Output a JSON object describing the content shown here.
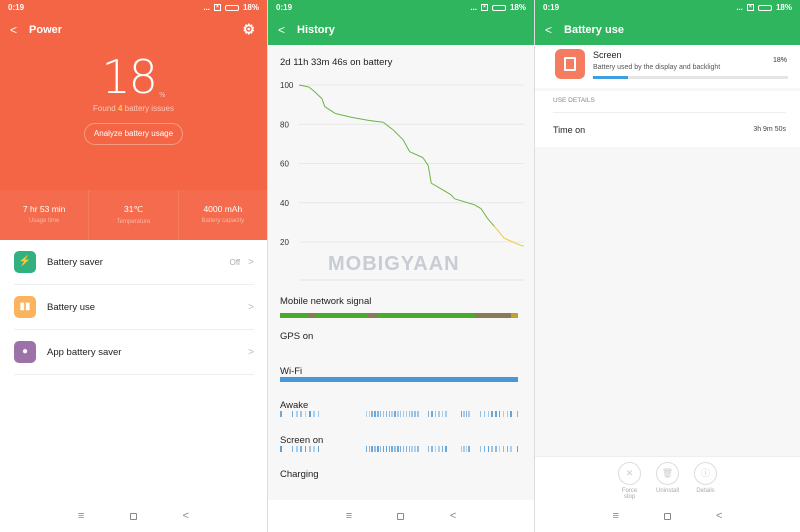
{
  "status": {
    "time": "0:19",
    "battery": "18%",
    "dots": "..."
  },
  "power": {
    "title": "Power",
    "percent": "18",
    "percent_unit": "%",
    "found_pre": "Found ",
    "issues": "4",
    "found_post": " battery issues",
    "analyze": "Analyze battery usage",
    "stats": [
      {
        "value": "7 hr 53 min",
        "label": "Usage time"
      },
      {
        "value": "31℃",
        "label": "Temperature"
      },
      {
        "value": "4000 mAh",
        "label": "Battery capacity"
      }
    ],
    "menu": [
      {
        "label": "Battery saver",
        "value": "Off",
        "icon": "battery-bolt-icon",
        "color": "#33b07f"
      },
      {
        "label": "Battery use",
        "value": "",
        "icon": "bar-chart-icon",
        "color": "#fbb35e"
      },
      {
        "label": "App battery saver",
        "value": "",
        "icon": "lightbulb-icon",
        "color": "#9c72a8"
      }
    ]
  },
  "history": {
    "title": "History",
    "on_battery": "2d 11h 33m 46s on battery",
    "rows": [
      "Mobile network signal",
      "GPS on",
      "Wi-Fi",
      "Awake",
      "Screen on",
      "Charging"
    ],
    "watermark": "MOBIGYAAN"
  },
  "chart_data": {
    "type": "line",
    "title": "2d 11h 33m 46s on battery",
    "xlabel": "",
    "ylabel": "",
    "x_unit": "hours on battery",
    "x": [
      0,
      2.6,
      3.9,
      6.1,
      6.8,
      9.6,
      14.0,
      18.4,
      22.3,
      25.0,
      27.6,
      29.3,
      32.8,
      34.2,
      35.0,
      37.7,
      40.3,
      41.2,
      46.4,
      48.2,
      49.9,
      51.7,
      54.3,
      56.9,
      59.1,
      59.56
    ],
    "values": [
      100,
      99,
      97,
      93,
      89,
      85.5,
      83.5,
      82,
      81,
      77,
      72,
      66,
      63,
      59,
      50,
      47,
      44,
      42,
      39,
      37,
      32,
      28,
      22,
      19.7,
      18,
      18
    ],
    "yticks": [
      100,
      80,
      60,
      40,
      20
    ],
    "ylim": [
      15,
      100
    ],
    "xlim": [
      0,
      59.56
    ],
    "grid": true,
    "colors": {
      "normal": "#6ab545",
      "low": "#f2c832"
    }
  },
  "battery_use": {
    "title": "Battery use",
    "app": {
      "name": "Screen",
      "desc": "Battery used by the display and backlight",
      "percent": "18%",
      "fill": 0.18
    },
    "section": "USE DETAILS",
    "time_on_label": "Time on",
    "time_on": "3h 9m 50s",
    "actions": [
      "Force stop",
      "Uninstall",
      "Details"
    ]
  },
  "colors": {
    "power": "#f46545",
    "green": "#2fb55e",
    "wifi": "#4a97d8"
  }
}
